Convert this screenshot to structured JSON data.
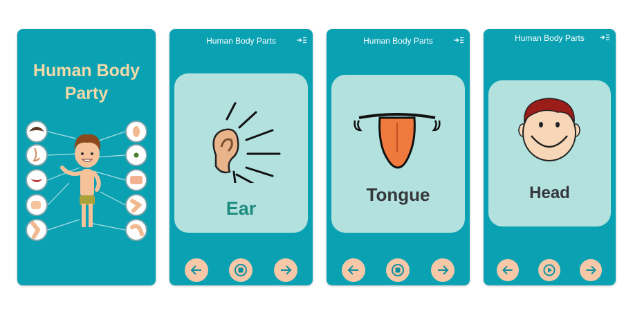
{
  "splash": {
    "title_line1": "Human Body",
    "title_line2": "Party"
  },
  "screens": [
    {
      "app_title": "Human Body Parts",
      "word": "Ear",
      "word_color": "#1f8c80",
      "play_state": "stop"
    },
    {
      "app_title": "Human Body Parts",
      "word": "Tongue",
      "word_color": "#35373b",
      "play_state": "stop"
    },
    {
      "app_title": "Human Body Parts",
      "word": "Head",
      "word_color": "#35373b",
      "play_state": "play"
    }
  ],
  "colors": {
    "background": "#0aa1b3",
    "card": "#b2e1de",
    "button": "#f6c8a8",
    "title": "#f2d9a8"
  },
  "icons": [
    "menu-icon",
    "arrow-left-icon",
    "stop-icon",
    "play-icon",
    "arrow-right-icon"
  ]
}
